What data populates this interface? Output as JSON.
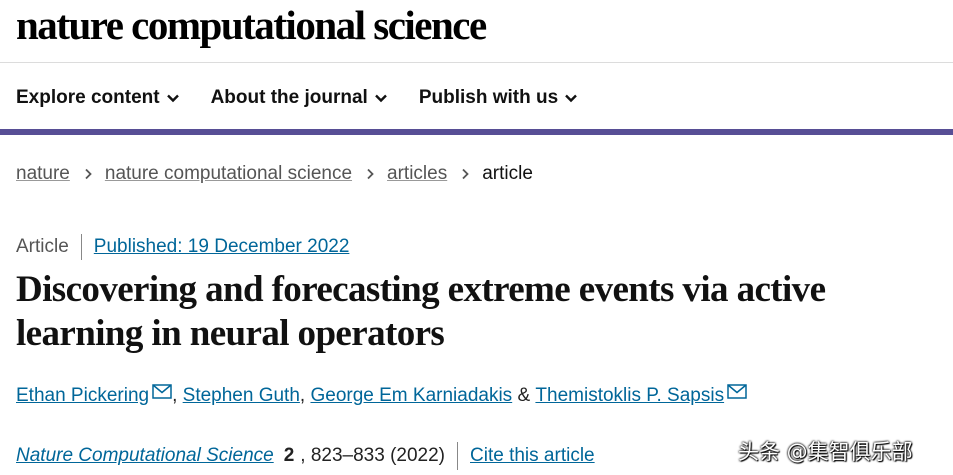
{
  "header": {
    "brand": "nature computational science"
  },
  "nav": {
    "items": [
      {
        "label": "Explore content"
      },
      {
        "label": "About the journal"
      },
      {
        "label": "Publish with us"
      }
    ]
  },
  "breadcrumb": {
    "items": [
      "nature",
      "nature computational science",
      "articles"
    ],
    "current": "article"
  },
  "article": {
    "type": "Article",
    "published": "Published: 19 December 2022",
    "title": "Discovering and forecasting extreme events via active learning in neural operators",
    "authors": [
      {
        "name": "Ethan Pickering",
        "mail": true
      },
      {
        "name": "Stephen Guth",
        "mail": false
      },
      {
        "name": "George Em Karniadakis",
        "mail": false
      },
      {
        "name": "Themistoklis P. Sapsis",
        "mail": true
      }
    ],
    "separators": [
      ", ",
      ", ",
      " & "
    ],
    "citation": {
      "journal": "Nature Computational Science",
      "volume": "2",
      "pages": ", 823–833 (2022)",
      "cite_label": "Cite this article"
    }
  },
  "watermark": "头条 @集智俱乐部",
  "colors": {
    "accent_bar": "#574e95",
    "link": "#006699"
  },
  "icons": {
    "dropdown": "chevron-down-icon",
    "breadcrumb_sep": "chevron-right-icon",
    "mail": "mail-icon"
  }
}
